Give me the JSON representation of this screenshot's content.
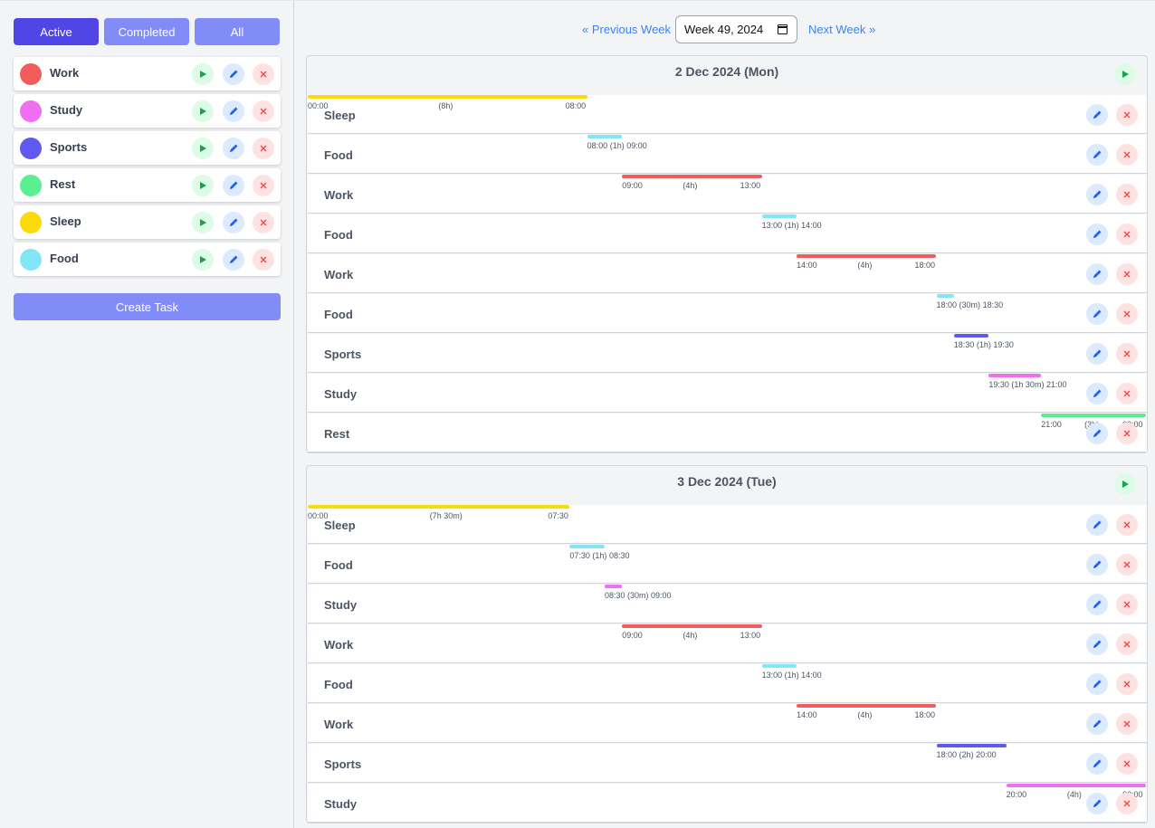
{
  "filters": [
    "Active",
    "Completed",
    "All"
  ],
  "active_filter": 0,
  "tasks": [
    {
      "name": "Work",
      "color": "#f25c5c"
    },
    {
      "name": "Study",
      "color": "#ef6ef2"
    },
    {
      "name": "Sports",
      "color": "#6059f0"
    },
    {
      "name": "Rest",
      "color": "#5af091"
    },
    {
      "name": "Sleep",
      "color": "#fbd90a"
    },
    {
      "name": "Food",
      "color": "#83e6f7"
    }
  ],
  "create_task_label": "Create Task",
  "week_nav": {
    "prev_label": "« Previous Week",
    "next_label": "Next Week »",
    "week_value": "Week 49, 2024"
  },
  "icons": {
    "play": "play-icon",
    "edit": "pencil-icon",
    "delete": "close-icon",
    "calendar": "calendar-icon"
  },
  "days": [
    {
      "title": "2 Dec 2024 (Mon)",
      "entries": [
        {
          "task": "Sleep",
          "start": "00:00",
          "end": "08:00",
          "duration": "(8h)"
        },
        {
          "task": "Food",
          "start": "08:00",
          "end": "09:00",
          "duration": "(1h)"
        },
        {
          "task": "Work",
          "start": "09:00",
          "end": "13:00",
          "duration": "(4h)"
        },
        {
          "task": "Food",
          "start": "13:00",
          "end": "14:00",
          "duration": "(1h)"
        },
        {
          "task": "Work",
          "start": "14:00",
          "end": "18:00",
          "duration": "(4h)"
        },
        {
          "task": "Food",
          "start": "18:00",
          "end": "18:30",
          "duration": "(30m)"
        },
        {
          "task": "Sports",
          "start": "18:30",
          "end": "19:30",
          "duration": "(1h)"
        },
        {
          "task": "Study",
          "start": "19:30",
          "end": "21:00",
          "duration": "(1h 30m)"
        },
        {
          "task": "Rest",
          "start": "21:00",
          "end": "00:00",
          "duration": "(3h)"
        }
      ]
    },
    {
      "title": "3 Dec 2024 (Tue)",
      "entries": [
        {
          "task": "Sleep",
          "start": "00:00",
          "end": "07:30",
          "duration": "(7h 30m)"
        },
        {
          "task": "Food",
          "start": "07:30",
          "end": "08:30",
          "duration": "(1h)"
        },
        {
          "task": "Study",
          "start": "08:30",
          "end": "09:00",
          "duration": "(30m)"
        },
        {
          "task": "Work",
          "start": "09:00",
          "end": "13:00",
          "duration": "(4h)"
        },
        {
          "task": "Food",
          "start": "13:00",
          "end": "14:00",
          "duration": "(1h)"
        },
        {
          "task": "Work",
          "start": "14:00",
          "end": "18:00",
          "duration": "(4h)"
        },
        {
          "task": "Sports",
          "start": "18:00",
          "end": "20:00",
          "duration": "(2h)"
        },
        {
          "task": "Study",
          "start": "20:00",
          "end": "00:00",
          "duration": "(4h)"
        }
      ]
    }
  ]
}
